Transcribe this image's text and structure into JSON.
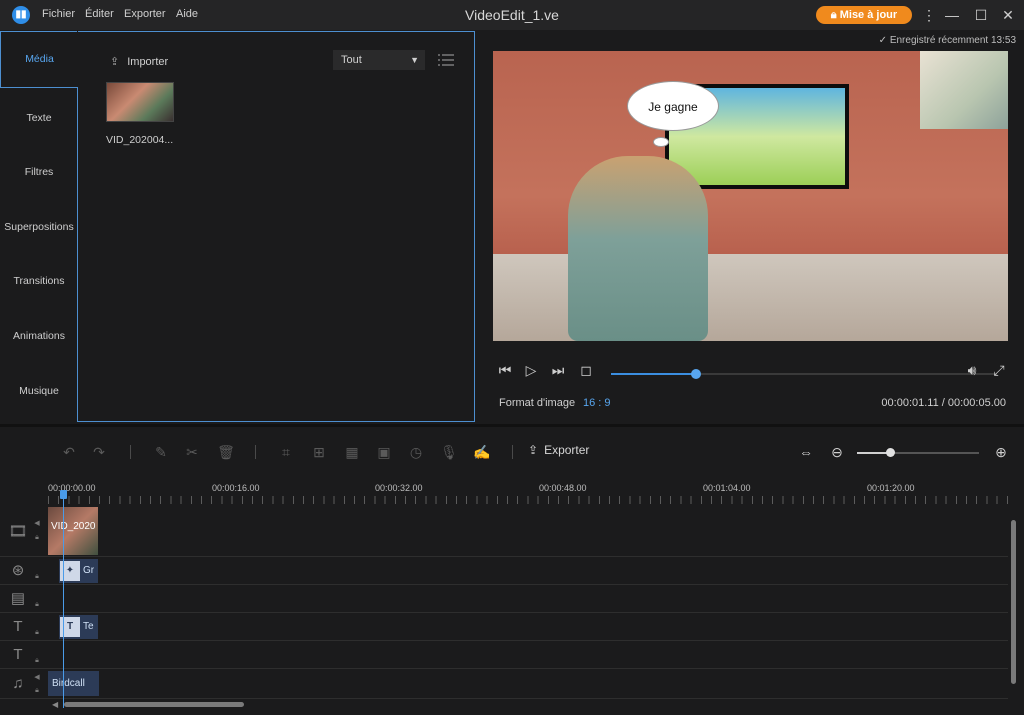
{
  "titlebar": {
    "title": "VideoEdit_1.ve",
    "menu": [
      "Fichier",
      "Éditer",
      "Exporter",
      "Aide"
    ],
    "update_label": "Mise à jour",
    "update_color": "#f08a1d"
  },
  "left_panel": {
    "tabs": [
      "Média",
      "Texte",
      "Filtres",
      "Superpositions",
      "Transitions",
      "Animations",
      "Musique"
    ],
    "active_tab": "Média",
    "import_label": "Importer",
    "filter_value": "Tout",
    "clip_name": "VID_202004..."
  },
  "preview": {
    "saved_label": "Enregistré récemment 13:53",
    "bubble_text": "Je gagne",
    "aspect_label": "Format d'image",
    "aspect_value": "16 : 9",
    "timecode": "00:00:01.11 / 00:00:05.00",
    "progress_fraction": 0.22
  },
  "toolbar": {
    "export_label": "Exporter",
    "zoom_fraction": 0.27
  },
  "ruler": {
    "labels": [
      "00:00:00.00",
      "00:00:16.00",
      "00:00:32.00",
      "00:00:48.00",
      "00:01:04.00",
      "00:01:20.00"
    ]
  },
  "tracks": {
    "video_clip": "VID_2020",
    "filter_clip": "Gr",
    "text_clip": "Te",
    "music_clip": "Birdcall"
  },
  "colors": {
    "accent": "#58a6ef",
    "clip": "#2c3b57"
  }
}
